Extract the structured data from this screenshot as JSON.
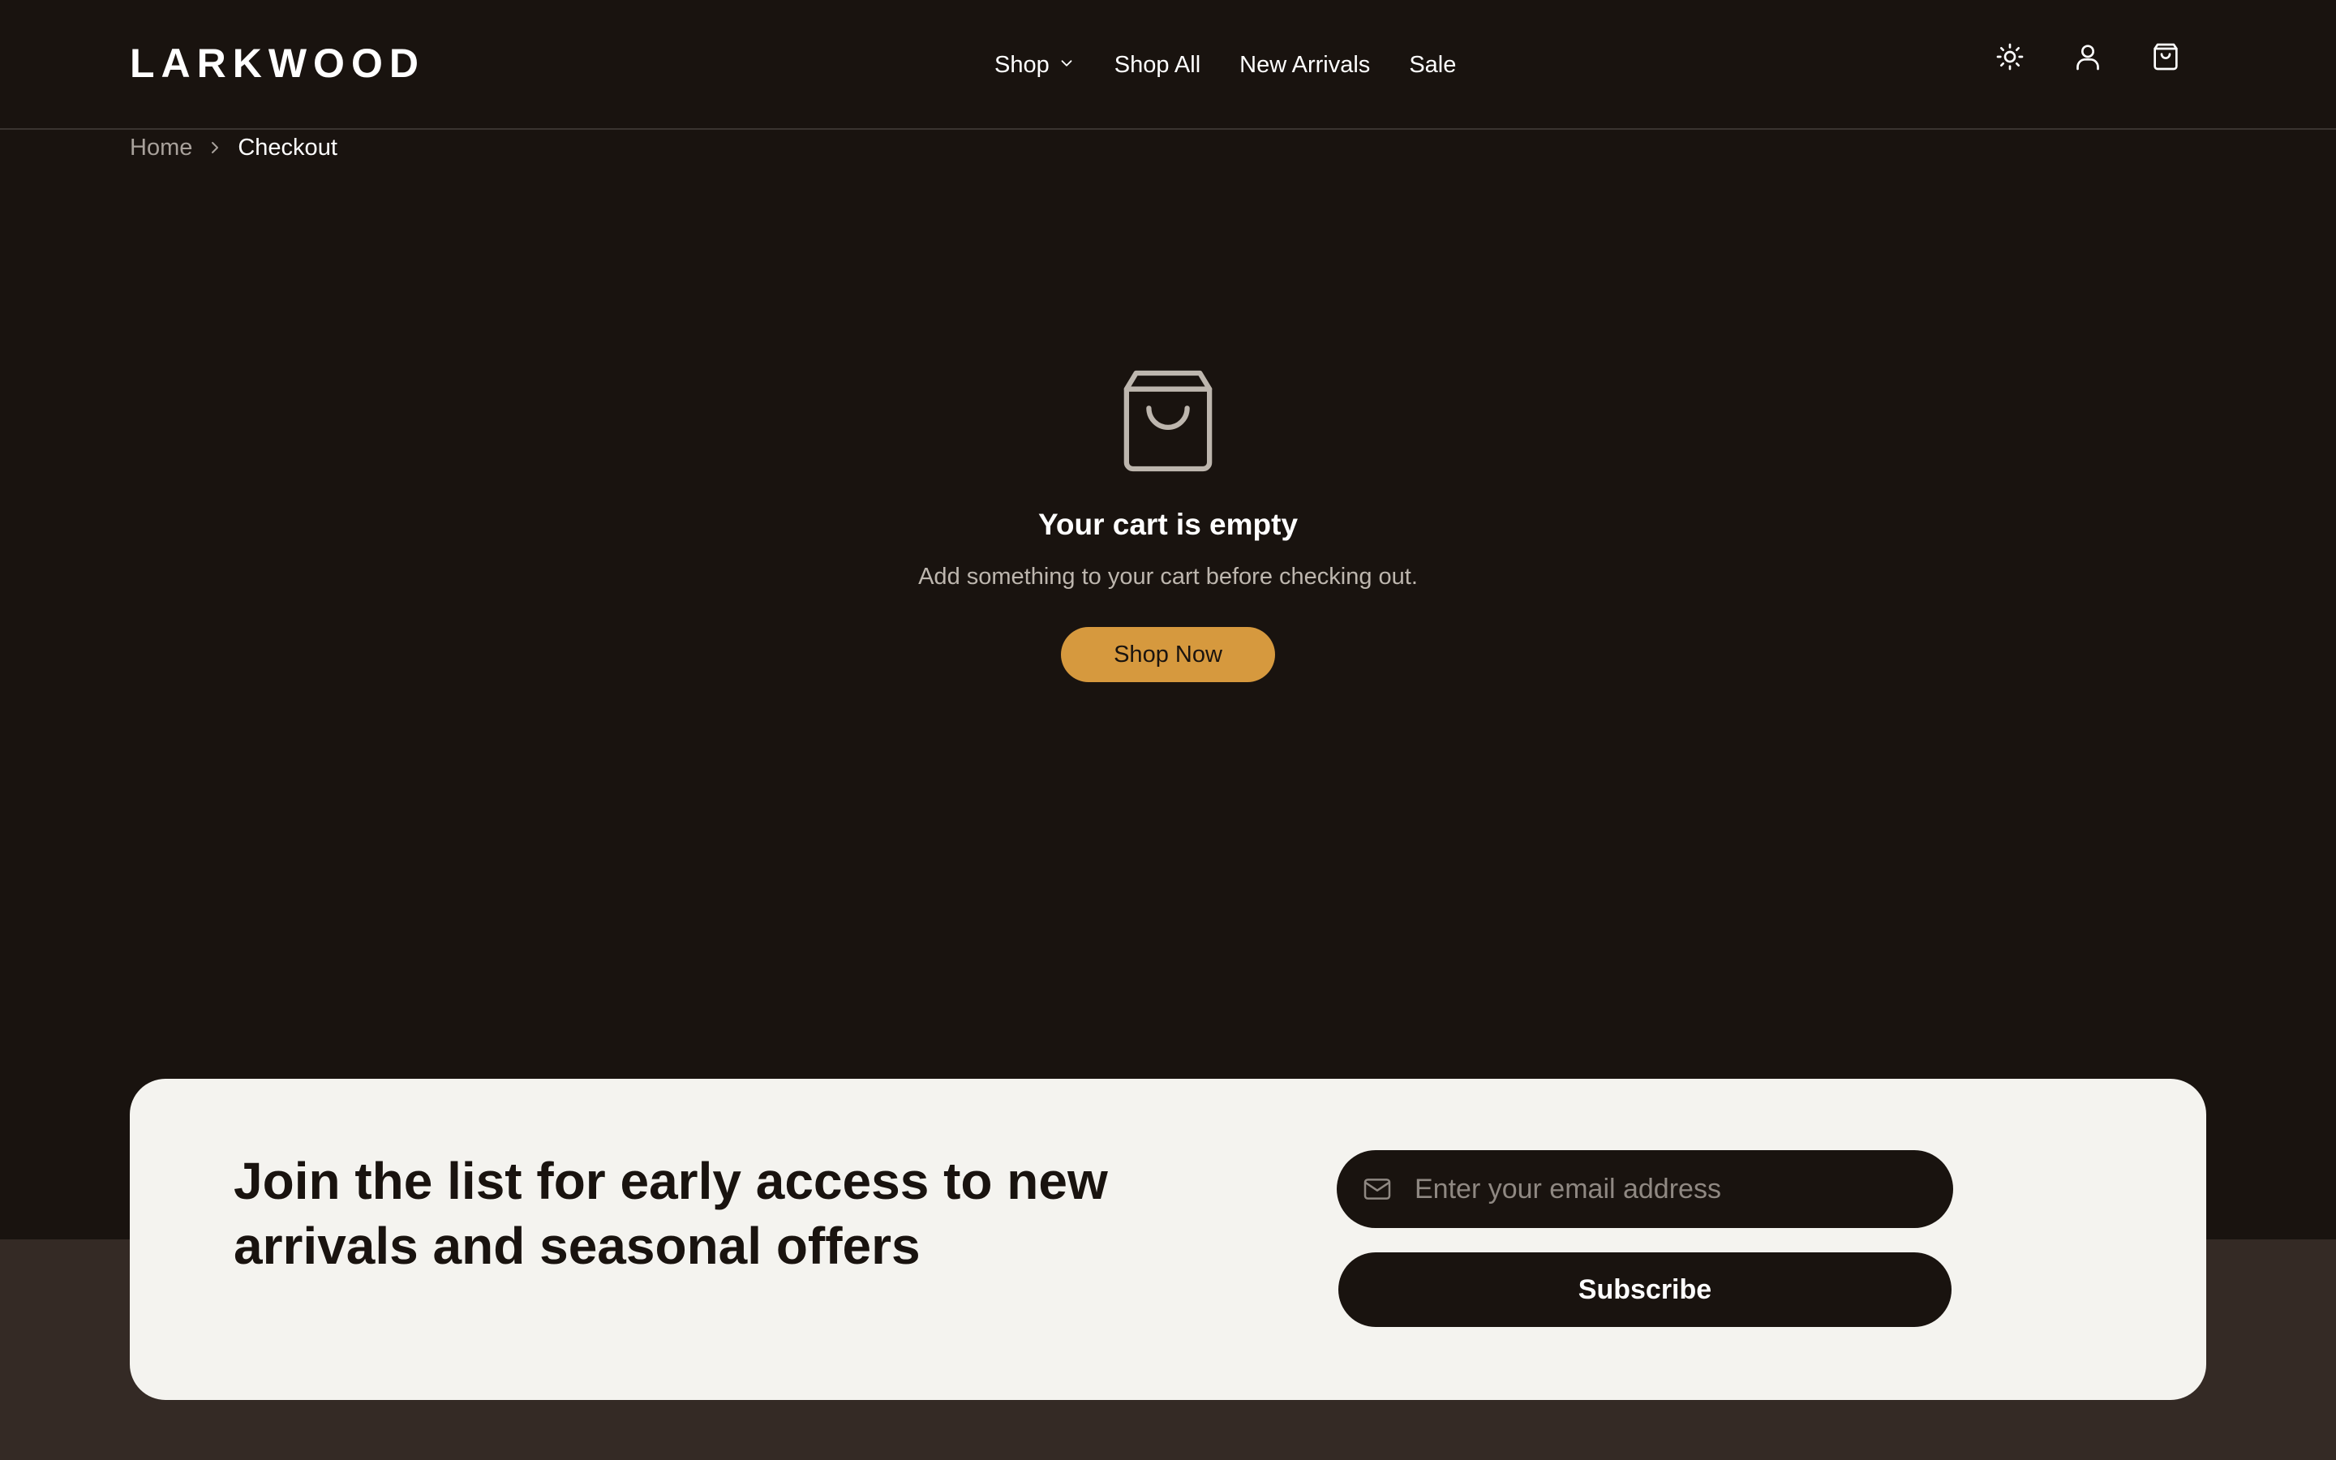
{
  "header": {
    "logo": "LARKWOOD",
    "nav": [
      {
        "label": "Shop",
        "has_dropdown": true
      },
      {
        "label": "Shop All"
      },
      {
        "label": "New Arrivals"
      },
      {
        "label": "Sale"
      }
    ],
    "icons": [
      "sun-icon",
      "user-icon",
      "shopping-bag-icon"
    ]
  },
  "breadcrumb": {
    "home": "Home",
    "current": "Checkout"
  },
  "empty_state": {
    "icon": "shopping-bag-icon",
    "title": "Your cart is empty",
    "subtitle": "Add something to your cart before checking out.",
    "button_label": "Shop Now"
  },
  "newsletter": {
    "heading": "Join the list for early access to new arrivals and seasonal offers",
    "email_placeholder": "Enter your email address",
    "email_value": "",
    "subscribe_label": "Subscribe"
  },
  "colors": {
    "background": "#19130f",
    "accent": "#d6993e",
    "card": "#f4f3ef",
    "footer": "#342a25"
  }
}
